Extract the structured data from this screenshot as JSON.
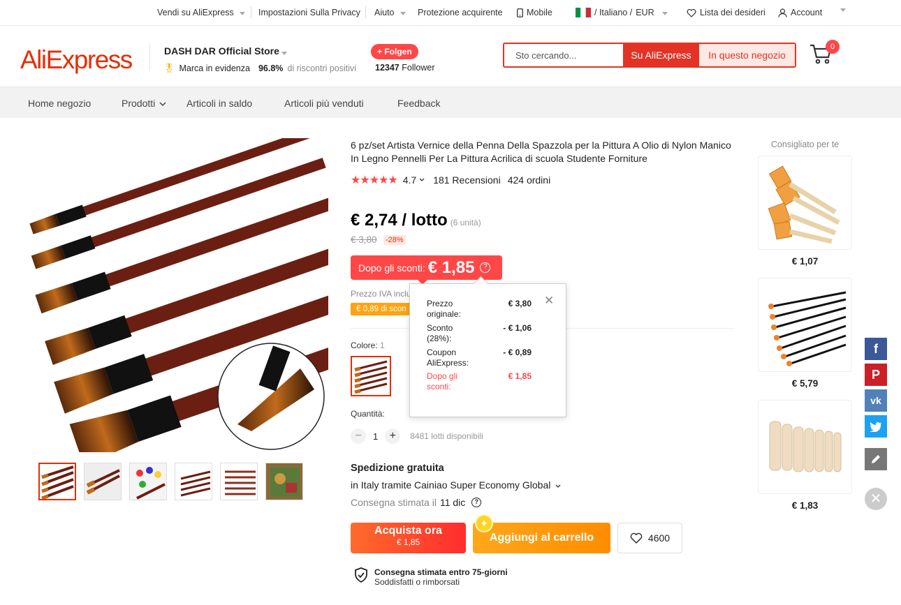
{
  "topbar": {
    "sell": "Vendi su AliExpress",
    "privacy": "Impostazioni Sulla Privacy",
    "help": "Aiuto",
    "protection": "Protezione acquirente",
    "mobile": "Mobile",
    "lang": "/ Italiano /",
    "currency": "EUR",
    "wishlist": "Lista dei desideri",
    "account": "Account"
  },
  "header": {
    "logo": "AliExpress",
    "store_name": "DASH DAR Official Store",
    "badge": "Marca in evidenza",
    "feedback_pct": "96.8%",
    "feedback_label": "di riscontri positivi",
    "follow": "+ Folgen",
    "followers_count": "12347",
    "followers_label": "Follower",
    "search_placeholder": "Sto cercando...",
    "search_ali": "Su AliExpress",
    "search_store": "In questo negozio",
    "cart_count": "0"
  },
  "nav": {
    "home": "Home negozio",
    "products": "Prodotti",
    "sale": "Articoli in saldo",
    "bestsellers": "Articoli più venduti",
    "feedback": "Feedback"
  },
  "product": {
    "title": "6 pz/set Artista Vernice della Penna Della Spazzola per la Pittura A Olio di Nylon Manico In Legno Pennelli Per La Pittura Acrilica di scuola Studente Forniture",
    "rating": "4.7",
    "reviews": "181 Recensioni",
    "orders": "424 ordini",
    "price": "€ 2,74 / lotto",
    "unit": "(6 unità)",
    "old_price": "€ 3,80",
    "discount": "-28%",
    "after_label": "Dopo gli sconti:",
    "after_price": "€ 1,85",
    "vat": "Prezzo IVA inclu",
    "coupon": "€ 0,89 di scon",
    "color_label": "Colore:",
    "color_value": "1",
    "qty_label": "Quantità:",
    "qty": "1",
    "stock": "8481 lotti disponibili",
    "shipping": "Spedizione gratuita",
    "ship_via": "in Italy tramite Cainiao Super Economy Global",
    "eta_label": "Consegna stimata il",
    "eta_value": "11 dic",
    "buy_label": "Acquista ora",
    "buy_price": "€ 1,85",
    "add_cart": "Aggiungi al carrello",
    "wish_count": "4600",
    "guarantee_title": "Consegna stimata entro 75-giorni",
    "guarantee_sub": "Soddisfatti o rimborsati"
  },
  "popup": {
    "r1k": "Prezzo originale:",
    "r1v": "€ 3,80",
    "r2k": "Sconto (28%):",
    "r2v": "- € 1,06",
    "r3k": "Coupon AliExpress:",
    "r3v": "- € 0,89",
    "r4k": "Dopo gli sconti:",
    "r4v": "€ 1,85"
  },
  "recommend": {
    "title": "Consigliato per te",
    "p1": "€ 1,07",
    "p2": "€ 5,79",
    "p3": "€ 1,83"
  },
  "colors": {
    "brand": "#e62e04",
    "accent": "#ff4747",
    "orange": "#ff8c00"
  }
}
